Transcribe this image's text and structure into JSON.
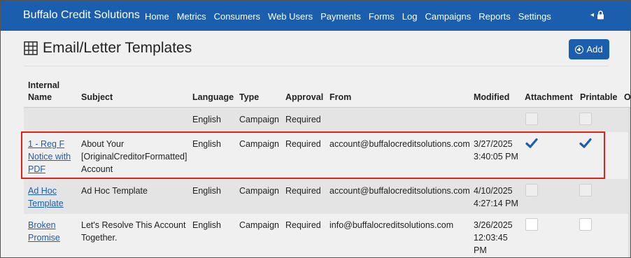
{
  "app": {
    "brand": "Buffalo Credit Solutions",
    "nav": [
      "Home",
      "Metrics",
      "Consumers",
      "Web Users",
      "Payments",
      "Forms",
      "Log",
      "Campaigns",
      "Reports",
      "Settings"
    ],
    "nav_right_caret": "◂",
    "lock_icon": "lock-icon"
  },
  "page": {
    "title": "Email/Letter Templates",
    "add_label": "Add",
    "accent": "#1b5eae",
    "highlight_color": "#e02020"
  },
  "table": {
    "headers": {
      "internal_name_1": "Internal",
      "internal_name_2": "Name",
      "subject": "Subject",
      "language": "Language",
      "type": "Type",
      "approval": "Approval",
      "from": "From",
      "modified": "Modified",
      "attachment": "Attachment",
      "printable": "Printable",
      "overflow": "O"
    },
    "rows": [
      {
        "name_lines": [],
        "subject_lines": [],
        "language": "English",
        "type": "Campaign",
        "approval": "Required",
        "from": "",
        "modified_lines": [],
        "attachment": false,
        "printable": false,
        "disabled": true
      },
      {
        "name_lines": [
          "1 - Reg F",
          "Notice with",
          "PDF"
        ],
        "subject_lines": [
          "About Your",
          "[OriginalCreditorFormatted]",
          "Account"
        ],
        "language": "English",
        "type": "Campaign",
        "approval": "Required",
        "from": "account@buffalocreditsolutions.com",
        "modified_lines": [
          "3/27/2025",
          "3:40:05 PM"
        ],
        "attachment": true,
        "printable": true,
        "disabled": false
      },
      {
        "name_lines": [
          "Ad Hoc",
          "Template"
        ],
        "subject_lines": [
          "Ad Hoc Template"
        ],
        "language": "English",
        "type": "Campaign",
        "approval": "Required",
        "from": "account@buffalocreditsolutions.com",
        "modified_lines": [
          "4/10/2025",
          "4:27:14 PM"
        ],
        "attachment": false,
        "printable": false,
        "disabled": true
      },
      {
        "name_lines": [
          "Broken",
          "Promise"
        ],
        "subject_lines": [
          "Let's Resolve This Account",
          "Together."
        ],
        "language": "English",
        "type": "Campaign",
        "approval": "Required",
        "from": "info@buffalocreditsolutions.com",
        "modified_lines": [
          "3/26/2025",
          "12:03:45",
          "PM"
        ],
        "attachment": false,
        "printable": false,
        "disabled": false
      }
    ]
  }
}
